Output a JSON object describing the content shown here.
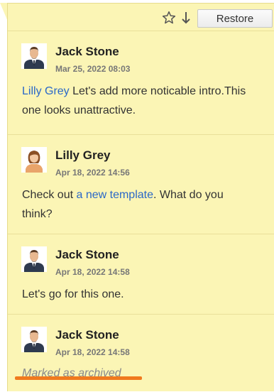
{
  "toolbar": {
    "star_icon": "star-outline-icon",
    "down_icon": "arrow-down-icon",
    "restore_label": "Restore"
  },
  "comments": [
    {
      "author": "Jack Stone",
      "avatar": "man-avatar-icon",
      "timestamp": "Mar 25, 2022 08:03",
      "mention": "Lilly Grey",
      "text": " Let's add more noticable intro.This one looks unattractive."
    },
    {
      "author": "Lilly Grey",
      "avatar": "woman-avatar-icon",
      "timestamp": "Apr 18, 2022 14:56",
      "text_before": "Check out ",
      "link": "a new template",
      "text_after": ". What do you think?"
    },
    {
      "author": "Jack Stone",
      "avatar": "man-avatar-icon",
      "timestamp": "Apr 18, 2022 14:58",
      "text": "Let's go for this one."
    },
    {
      "author": "Jack Stone",
      "avatar": "man-avatar-icon",
      "timestamp": "Apr 18, 2022 14:58",
      "status": "Marked as archived"
    }
  ],
  "colors": {
    "panel_background": "#fbf5b5",
    "link": "#2a68c8",
    "highlight_underline": "#f07a1e"
  }
}
